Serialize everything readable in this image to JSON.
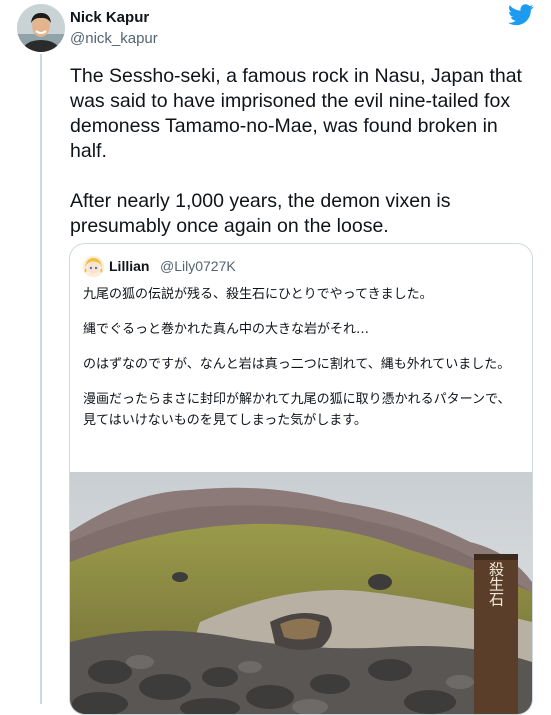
{
  "tweet": {
    "author_name": "Nick Kapur",
    "author_handle": "@nick_kapur",
    "paragraphs": [
      "The Sessho-seki, a famous rock in Nasu, Japan that was said to have imprisoned the evil nine-tailed fox demoness Tamamo-no-Mae, was found broken in half.",
      "After nearly 1,000 years, the demon vixen is presumably once again on the loose."
    ]
  },
  "quoted_tweet": {
    "author_name": "Lillian",
    "author_handle": "@Lily0727K",
    "paragraphs": [
      "九尾の狐の伝説が残る、殺生石にひとりでやってきました。",
      "縄でぐるっと巻かれた真ん中の大きな岩がそれ…",
      "のはずなのですが、なんと岩は真っ二つに割れて、縄も外れていました。",
      "漫画だったらまさに封印が解かれて九尾の狐に取り憑かれるパターンで、見てはいけないものを見てしまった気がします。"
    ],
    "photo": {
      "signpost_text": "殺生石"
    }
  },
  "icons": {
    "brand": "twitter-bird-icon",
    "brand_color": "#1d9bf0"
  }
}
